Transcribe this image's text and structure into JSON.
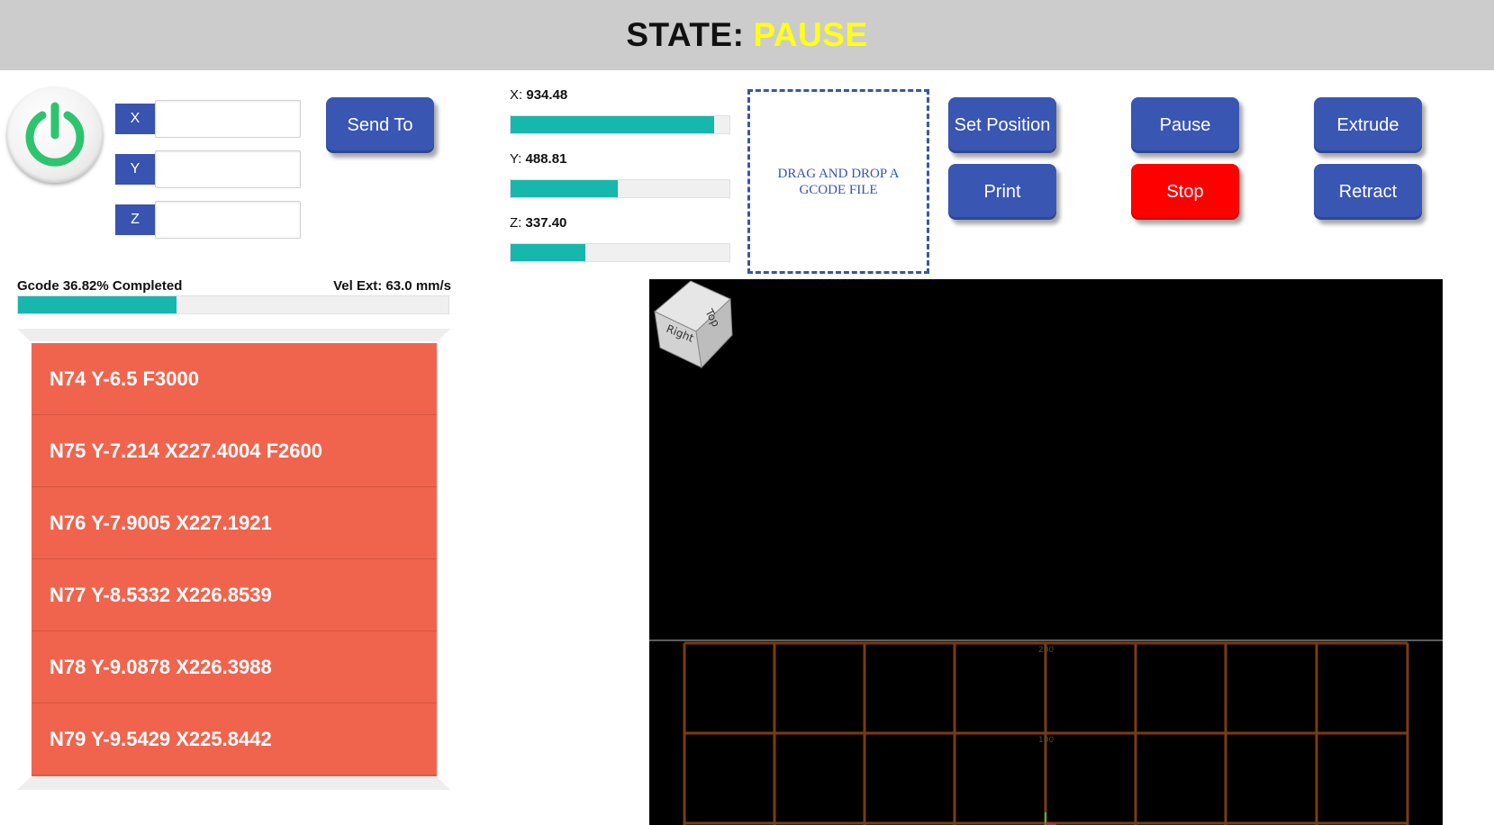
{
  "header": {
    "state_label": "STATE:",
    "state_value": "PAUSE",
    "state_color": "#ffff1a"
  },
  "power_button": {
    "icon": "power-icon",
    "color": "#2ec46e"
  },
  "axes": [
    {
      "label": "X",
      "value": "",
      "placeholder": ""
    },
    {
      "label": "Y",
      "value": "",
      "placeholder": ""
    },
    {
      "label": "Z",
      "value": "",
      "placeholder": ""
    }
  ],
  "buttons": {
    "send_to": "Send To",
    "set_position": "Set Position",
    "print": "Print",
    "pause": "Pause",
    "stop": "Stop",
    "extrude": "Extrude",
    "retract": "Retract"
  },
  "positions": [
    {
      "axis": "X:",
      "value": "934.48",
      "fill_percent": 93
    },
    {
      "axis": "Y:",
      "value": "488.81",
      "fill_percent": 49
    },
    {
      "axis": "Z:",
      "value": "337.40",
      "fill_percent": 34
    }
  ],
  "dropzone": {
    "text": "DRAG AND DROP A GCODE FILE"
  },
  "gcode_progress": {
    "label": "Gcode 36.82% Completed",
    "percent": 36.82,
    "velocity": "Vel Ext: 63.0 mm/s"
  },
  "gcode_lines": [
    "N74 Y-6.5 F3000",
    "N75 Y-7.214 X227.4004 F2600",
    "N76 Y-7.9005 X227.1921",
    "N77 Y-8.5332 X226.8539",
    "N78 Y-9.0878 X226.3988",
    "N79 Y-9.5429 X225.8442"
  ],
  "viewer": {
    "cube_faces": {
      "top": "Top",
      "right": "Right"
    },
    "grid_labels": [
      "200",
      "100"
    ],
    "grid_color": "#7a3b12",
    "background": "#000000"
  }
}
